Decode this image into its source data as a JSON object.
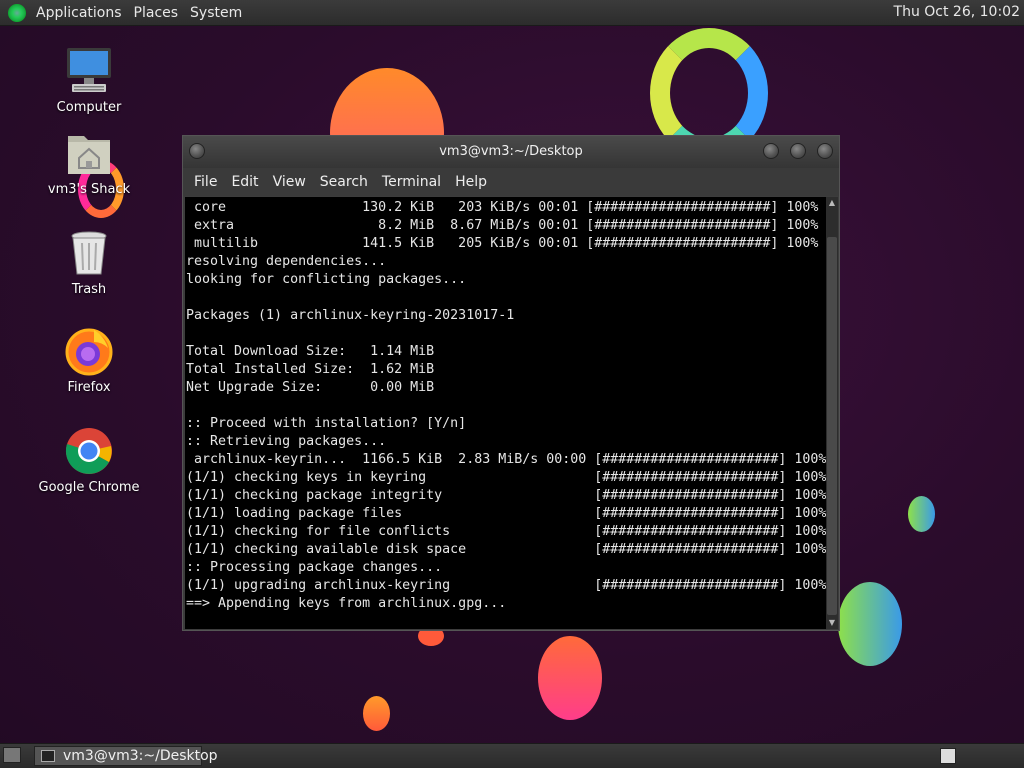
{
  "top_panel": {
    "menus": [
      "Applications",
      "Places",
      "System"
    ],
    "clock": "Thu Oct 26, 10:02"
  },
  "desktop_icons": [
    {
      "label": "Computer",
      "icon": "computer-icon"
    },
    {
      "label": "vm3's Shack",
      "icon": "home-folder-icon"
    },
    {
      "label": "Trash",
      "icon": "trash-icon"
    },
    {
      "label": "Firefox",
      "icon": "firefox-icon"
    },
    {
      "label": "Google Chrome",
      "icon": "chrome-icon"
    }
  ],
  "terminal": {
    "title": "vm3@vm3:~/Desktop",
    "menus": [
      "File",
      "Edit",
      "View",
      "Search",
      "Terminal",
      "Help"
    ],
    "lines": [
      " core                 130.2 KiB   203 KiB/s 00:01 [######################] 100%",
      " extra                  8.2 MiB  8.67 MiB/s 00:01 [######################] 100%",
      " multilib             141.5 KiB   205 KiB/s 00:01 [######################] 100%",
      "resolving dependencies...",
      "looking for conflicting packages...",
      "",
      "Packages (1) archlinux-keyring-20231017-1",
      "",
      "Total Download Size:   1.14 MiB",
      "Total Installed Size:  1.62 MiB",
      "Net Upgrade Size:      0.00 MiB",
      "",
      ":: Proceed with installation? [Y/n]",
      ":: Retrieving packages...",
      " archlinux-keyrin...  1166.5 KiB  2.83 MiB/s 00:00 [######################] 100%",
      "(1/1) checking keys in keyring                     [######################] 100%",
      "(1/1) checking package integrity                   [######################] 100%",
      "(1/1) loading package files                        [######################] 100%",
      "(1/1) checking for file conflicts                  [######################] 100%",
      "(1/1) checking available disk space                [######################] 100%",
      ":: Processing package changes...",
      "(1/1) upgrading archlinux-keyring                  [######################] 100%",
      "==> Appending keys from archlinux.gpg..."
    ]
  },
  "taskbar": {
    "window_button": "vm3@vm3:~/Desktop"
  },
  "colors": {
    "wallpaper": "#2a0d2c",
    "terminal_bg": "#000000",
    "terminal_fg": "#e6e6e6",
    "panel": "#333333"
  }
}
